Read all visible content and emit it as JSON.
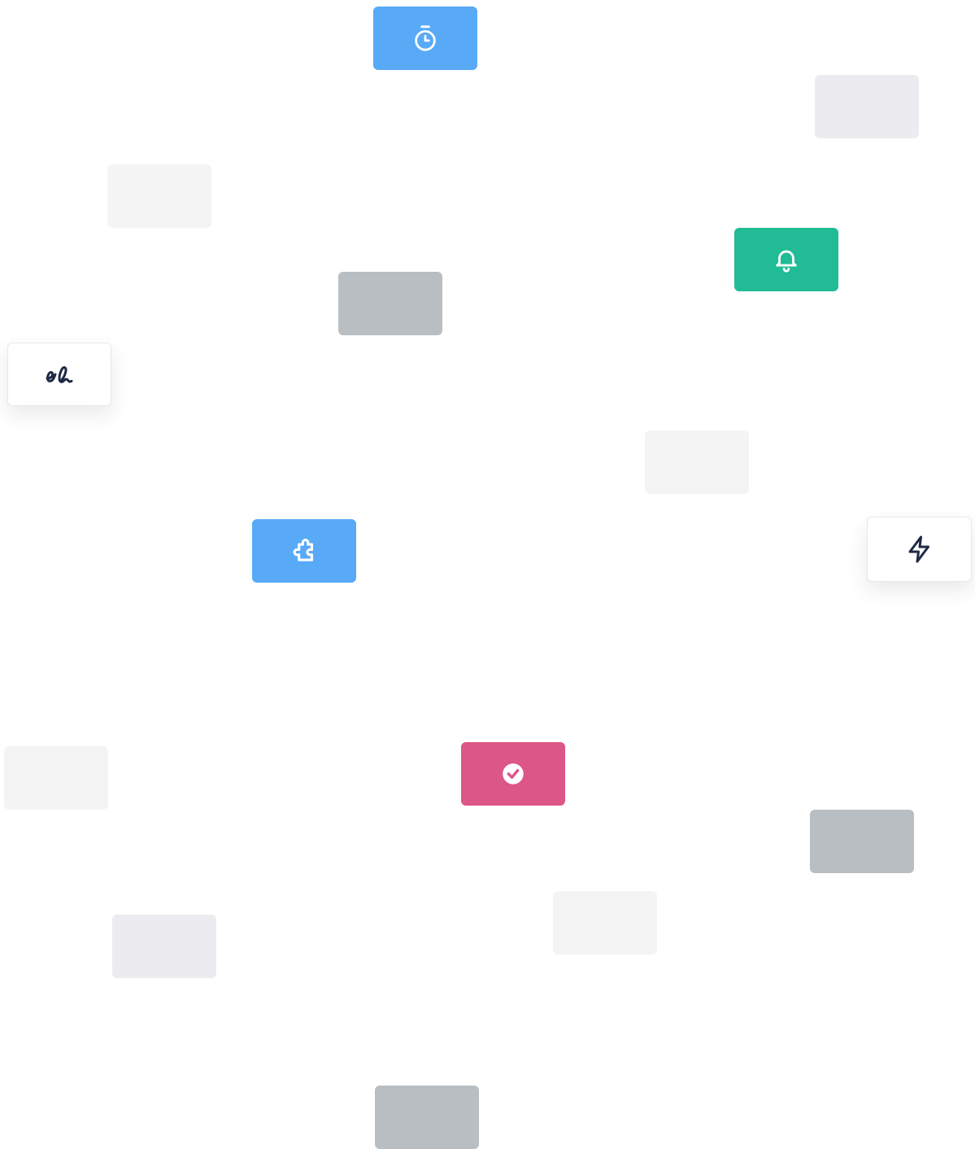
{
  "tiles": [
    {
      "name": "stopwatch-tile",
      "icon": "stopwatch-icon",
      "color": "#58aaf6"
    },
    {
      "name": "placeholder-tile",
      "color": "#ececf0"
    },
    {
      "name": "placeholder-tile",
      "color": "#f4f4f5"
    },
    {
      "name": "bell-tile",
      "icon": "bell-icon",
      "color": "#21bb95"
    },
    {
      "name": "placeholder-tile",
      "color": "#b9bec2"
    },
    {
      "name": "signature-tile",
      "icon": "signature-icon",
      "color": "#ffffff"
    },
    {
      "name": "placeholder-tile",
      "color": "#f4f4f5"
    },
    {
      "name": "puzzle-tile",
      "icon": "puzzle-icon",
      "color": "#58aaf6"
    },
    {
      "name": "lightning-tile",
      "icon": "lightning-icon",
      "color": "#ffffff"
    },
    {
      "name": "placeholder-tile",
      "color": "#f4f4f5"
    },
    {
      "name": "check-circle-tile",
      "icon": "check-circle-icon",
      "color": "#dc5687"
    },
    {
      "name": "placeholder-tile",
      "color": "#b9bec2"
    },
    {
      "name": "placeholder-tile",
      "color": "#f4f4f5"
    },
    {
      "name": "placeholder-tile",
      "color": "#ececf0"
    },
    {
      "name": "placeholder-tile",
      "color": "#b9bec2"
    }
  ]
}
